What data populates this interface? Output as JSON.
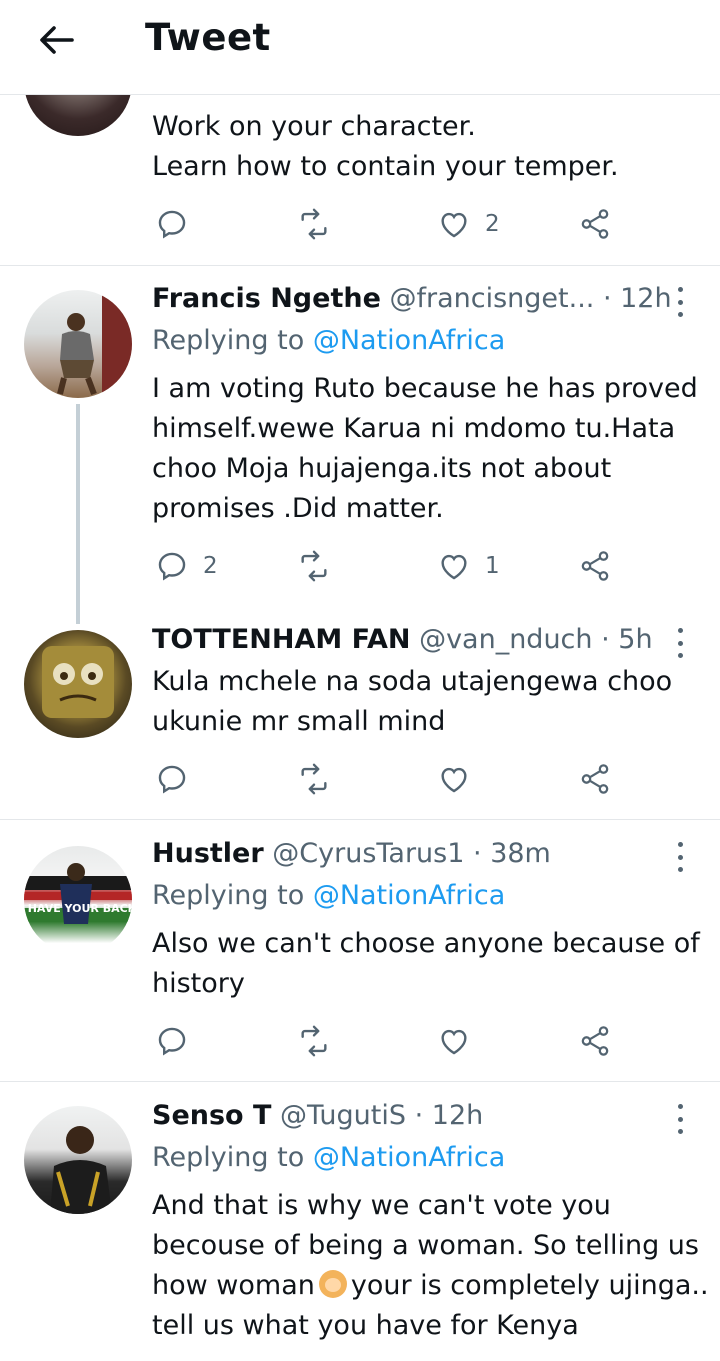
{
  "header": {
    "title": "Tweet"
  },
  "partial_tweet": {
    "lines": [
      "Work on your character.",
      "Learn how to contain your temper."
    ],
    "likes": "2"
  },
  "tweets": [
    {
      "name": "Francis Ngethe",
      "handle": "@francisnget...",
      "time": "12h",
      "replying_prefix": "Replying to ",
      "replying_to": "@NationAfrica",
      "text": "I  am voting Ruto because he has proved himself.wewe Karua ni mdomo tu.Hata choo Moja hujajenga.its not about promises .Did matter.",
      "replies": "2",
      "likes": "1"
    },
    {
      "name": "TOTTENHAM FAN",
      "handle": "@van_nduch",
      "time": "5h",
      "text": "Kula mchele na soda utajengewa choo ukunie mr small mind"
    },
    {
      "name": "Hustler",
      "handle": "@CyrusTarus1",
      "time": "38m",
      "replying_prefix": "Replying to ",
      "replying_to": "@NationAfrica",
      "text": "Also we can't choose anyone because of history",
      "avatar_text": "I HAVE YOUR BACK"
    },
    {
      "name": "Senso T",
      "handle": "@TugutiS",
      "time": "12h",
      "replying_prefix": "Replying to ",
      "replying_to": "@NationAfrica",
      "text_part1": "And that is why we can't vote you becouse of being a woman. So telling us how woman",
      "text_part2": "your is completely ujinga.. tell us what you have for Kenya"
    }
  ],
  "icons": {
    "reply": "reply-icon",
    "retweet": "retweet-icon",
    "like": "like-icon",
    "share": "share-icon"
  },
  "colors": {
    "link": "#1d9bf0",
    "secondary": "#536471",
    "text": "#0f1419"
  }
}
